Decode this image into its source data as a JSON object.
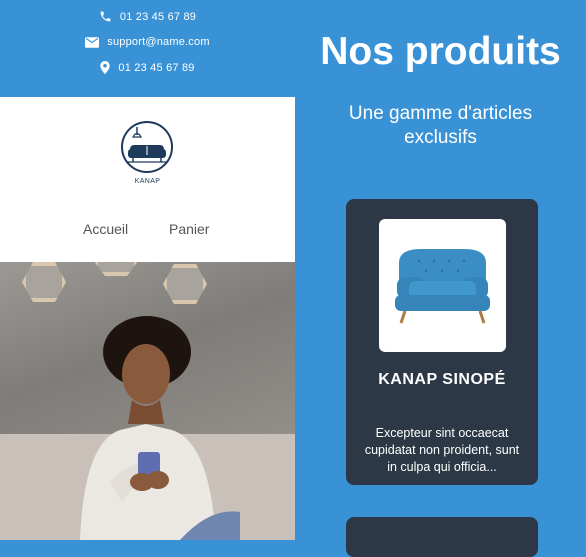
{
  "header": {
    "phone": "01 23 45 67 89",
    "email": "support@name.com",
    "address": "01 23 45 67 89"
  },
  "brand": {
    "logo_text": "KANAP"
  },
  "nav": {
    "home": "Accueil",
    "cart": "Panier"
  },
  "products_section": {
    "title": "Nos produits",
    "subtitle": "Une gamme d'articles exclusifs"
  },
  "products": [
    {
      "name": "KANAP SINOPÉ",
      "description": "Excepteur sint occaecat cupidatat non proident, sunt in culpa qui officia..."
    }
  ],
  "colors": {
    "primary_blue": "#3a92d6",
    "card_dark": "#2c3845",
    "sofa_blue": "#3a8ec4"
  },
  "icons": {
    "phone": "phone-icon",
    "email": "envelope-icon",
    "address": "map-pin-icon"
  }
}
